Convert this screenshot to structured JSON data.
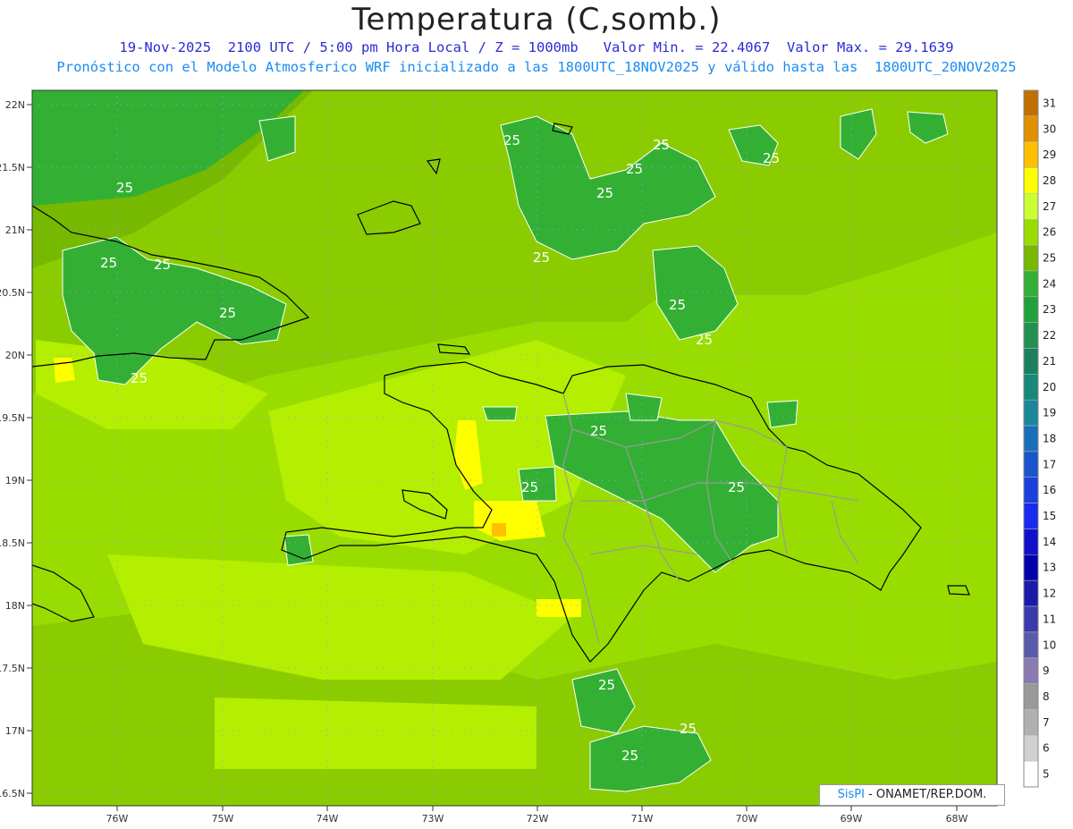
{
  "header": {
    "title": "Temperatura (C,somb.)",
    "subtitle1": "19-Nov-2025  2100 UTC / 5:00 pm Hora Local / Z = 1000mb   Valor Min. = 22.4067  Valor Max. = 29.1639",
    "subtitle2": "Pronóstico con el Modelo Atmosferico WRF inicializado a las 1800UTC_18NOV2025 y válido hasta las  1800UTC_20NOV2025"
  },
  "axes": {
    "lat_labels": [
      "22N",
      "21.5N",
      "21N",
      "20.5N",
      "20N",
      "19.5N",
      "19N",
      "18.5N",
      "18N",
      "17.5N",
      "17N",
      "16.5N"
    ],
    "lon_labels": [
      "76W",
      "75W",
      "74W",
      "73W",
      "72W",
      "71W",
      "70W",
      "69W",
      "68W"
    ]
  },
  "contour_labels": [
    "25",
    "25",
    "25",
    "25",
    "25",
    "25",
    "25",
    "25",
    "25",
    "25",
    "25",
    "25",
    "25",
    "25",
    "25",
    "25",
    "25",
    "25",
    "25",
    "25"
  ],
  "colorbar": {
    "levels": [
      "31",
      "30",
      "29",
      "28",
      "27",
      "26",
      "25",
      "24",
      "23",
      "22",
      "21",
      "20",
      "19",
      "18",
      "17",
      "16",
      "15",
      "14",
      "13",
      "12",
      "11",
      "10",
      "9",
      "8",
      "7",
      "6",
      "5"
    ],
    "colors": [
      "#c07000",
      "#e09000",
      "#ffc000",
      "#ffff00",
      "#ccff33",
      "#99dd00",
      "#77b800",
      "#33b033",
      "#22a03c",
      "#229050",
      "#1a8060",
      "#188878",
      "#1a8898",
      "#1a70b8",
      "#1a55cc",
      "#1a3fdd",
      "#1a2aee",
      "#1010cc",
      "#0000aa",
      "#1a1aaa",
      "#3a3aaa",
      "#5a5aaa",
      "#8a7ab0",
      "#999999",
      "#b0b0b0",
      "#d0d0d0",
      "#ffffff"
    ]
  },
  "credit": {
    "brand": "SisPI",
    "text": "- ONAMET/REP.DOM."
  }
}
